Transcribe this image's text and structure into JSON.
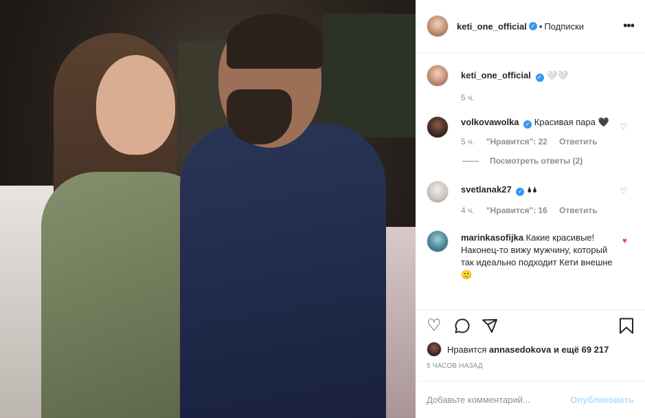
{
  "post": {
    "author": "keti_one_official",
    "follow_status": "Подписки",
    "caption_text": "🤍🤍",
    "caption_time": "5 ч."
  },
  "comments": [
    {
      "username": "volkovawolka",
      "verified": true,
      "text": "Красивая пара 🖤",
      "time": "5 ч.",
      "likes": "\"Нравится\": 22",
      "reply": "Ответить",
      "liked": false
    },
    {
      "username": "svetlanak27",
      "verified": true,
      "text": "🌢🌢",
      "time": "4 ч.",
      "likes": "\"Нравится\": 16",
      "reply": "Ответить",
      "liked": false
    },
    {
      "username": "marinkasofijka",
      "verified": false,
      "text": "Какие красивые! Наконец-то вижу мужчину, который так идеально подходит Кети внешне 🙂",
      "liked": true
    }
  ],
  "view_replies": "Посмотреть ответы (2)",
  "likes": {
    "prefix": "Нравится",
    "user": "annasedokova",
    "suffix": "и ещё 69 217"
  },
  "post_time": "5 ЧАСОВ НАЗАД",
  "comment_box": {
    "placeholder": "Добавьте комментарий...",
    "post_label": "Опубликовать"
  },
  "icons": {
    "more": "more-icon",
    "like": "heart-icon",
    "comment": "comment-icon",
    "share": "share-icon",
    "save": "bookmark-icon"
  },
  "colors": {
    "verified": "#3897f0",
    "liked_heart": "#ed4956",
    "post_button": "#b2dffc"
  }
}
